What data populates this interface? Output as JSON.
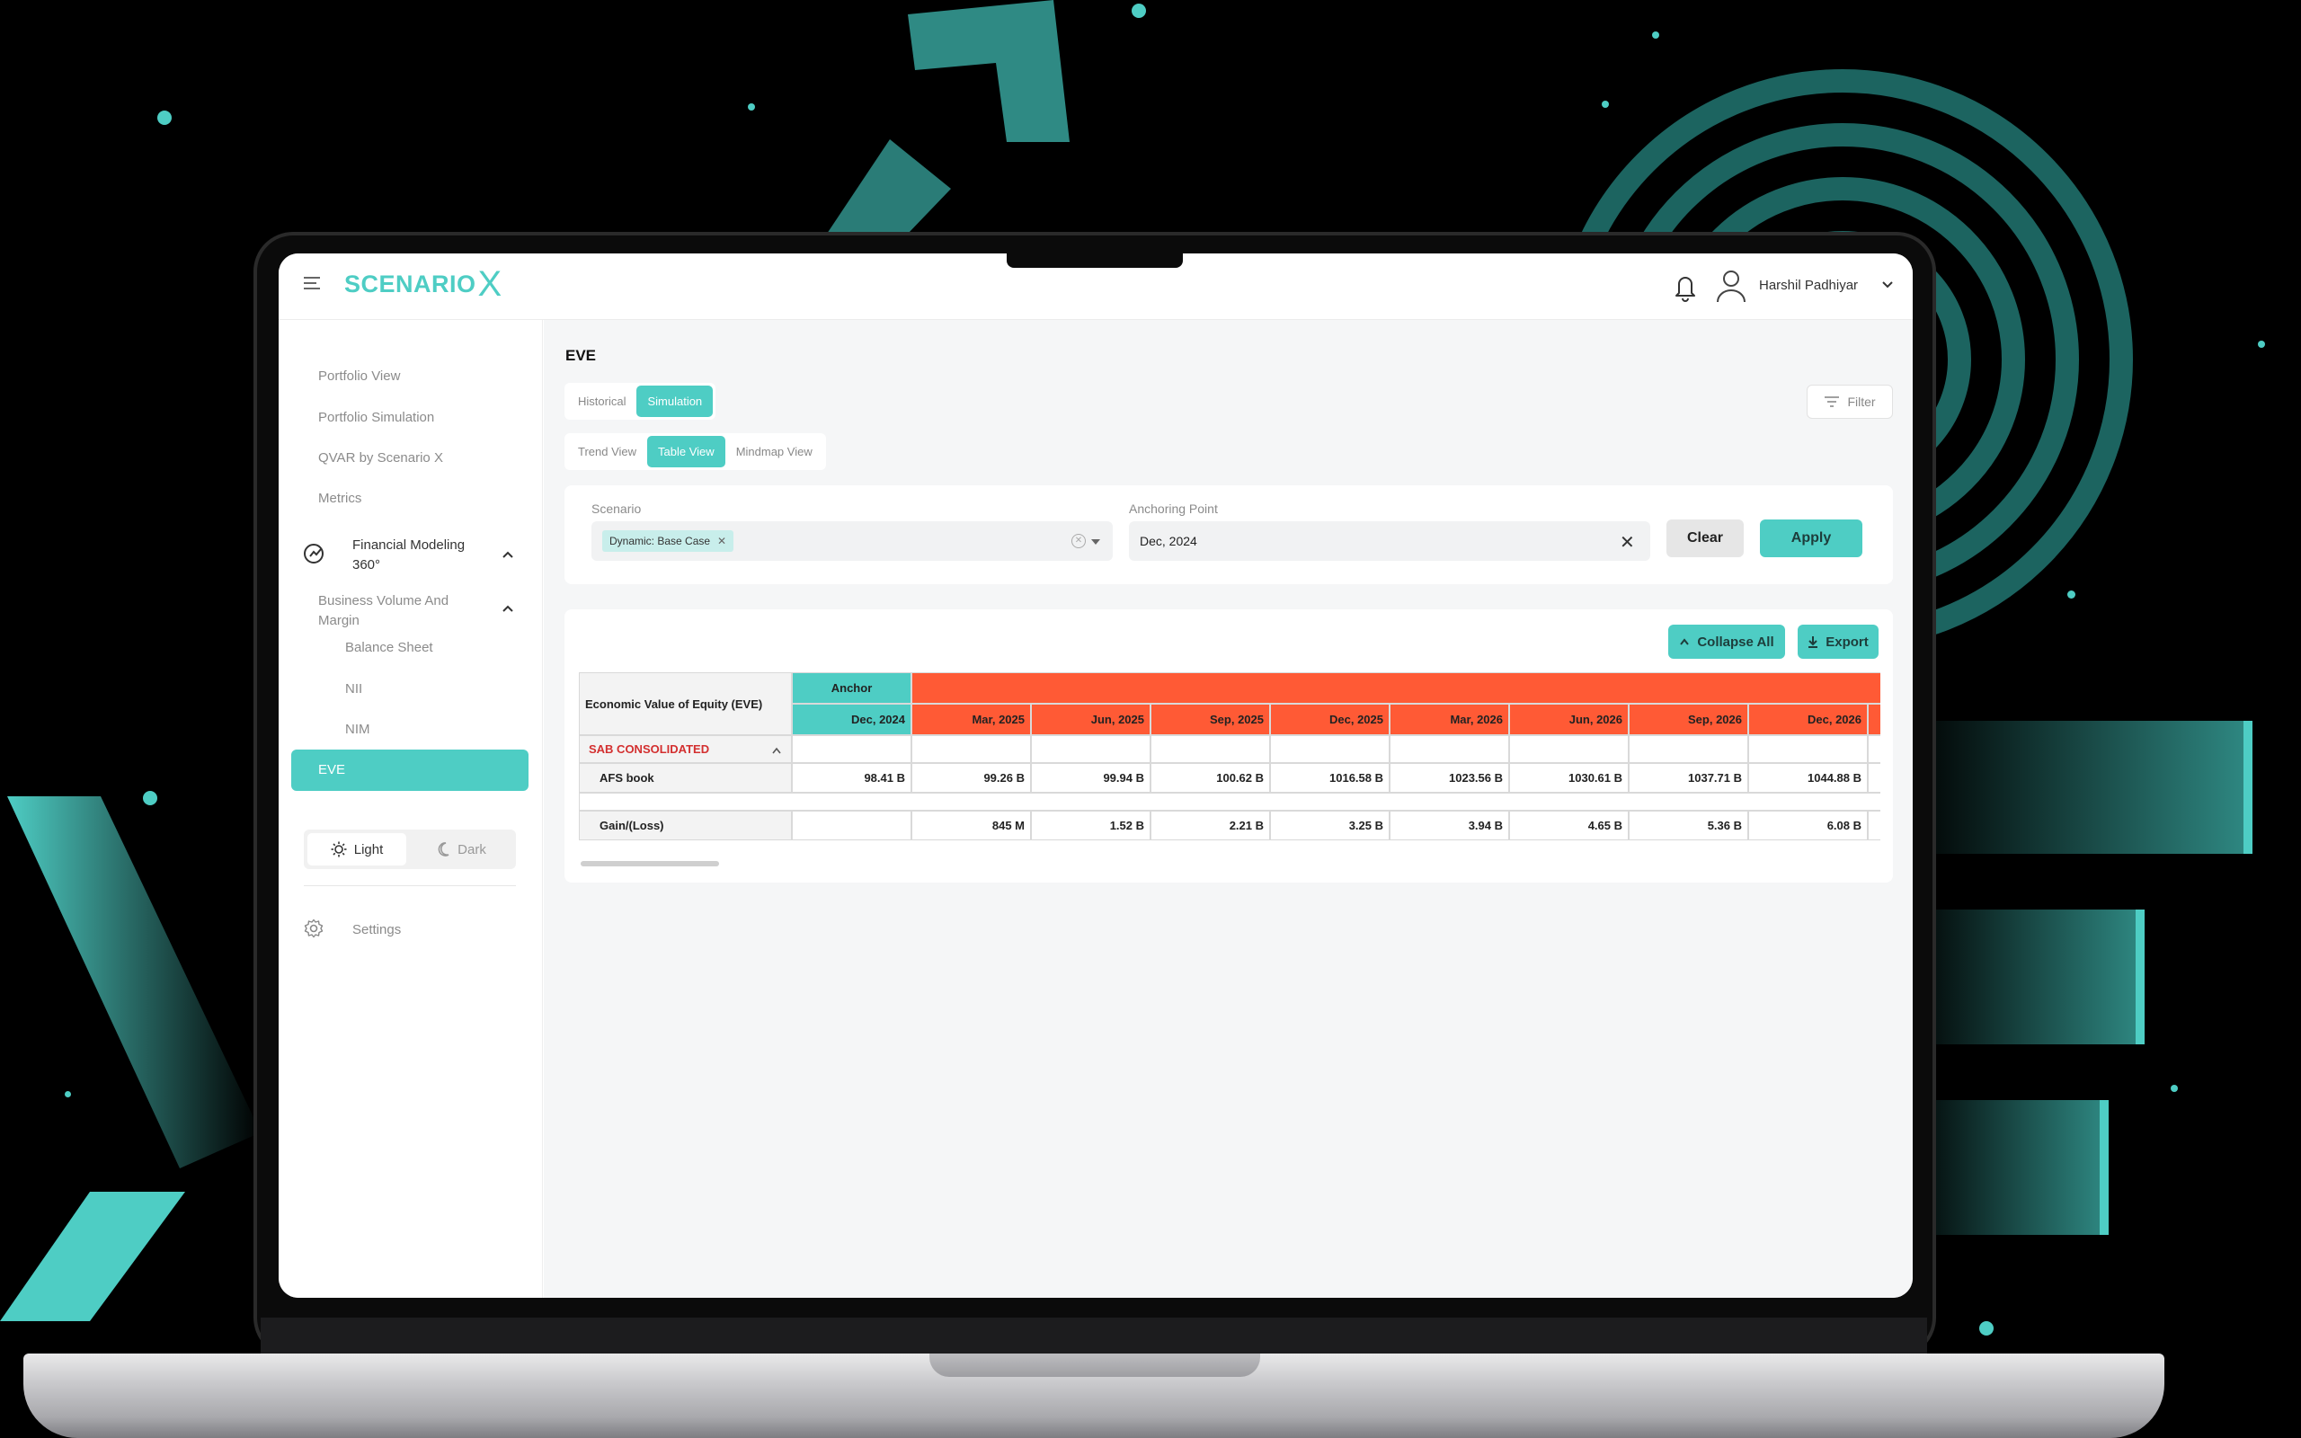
{
  "header": {
    "logo_text": "SCENARIO",
    "logo_mark": "X",
    "user_name": "Harshil Padhiyar"
  },
  "sidebar": {
    "items": [
      {
        "label": "Portfolio View"
      },
      {
        "label": "Portfolio Simulation"
      },
      {
        "label": "QVAR by Scenario X"
      },
      {
        "label": "Metrics"
      }
    ],
    "financial_modeling": "Financial Modeling 360°",
    "business_volume": "Business Volume And Margin",
    "sub_items": [
      {
        "label": "Balance Sheet"
      },
      {
        "label": "NII"
      },
      {
        "label": "NIM"
      }
    ],
    "active_item": "EVE",
    "theme": {
      "light": "Light",
      "dark": "Dark"
    },
    "settings": "Settings"
  },
  "main": {
    "title": "EVE",
    "mode_tabs": [
      {
        "label": "Historical",
        "active": false
      },
      {
        "label": "Simulation",
        "active": true
      }
    ],
    "view_tabs": [
      {
        "label": "Trend View",
        "active": false
      },
      {
        "label": "Table View",
        "active": true
      },
      {
        "label": "Mindmap View",
        "active": false
      }
    ],
    "filter_label": "Filter",
    "scenario": {
      "label": "Scenario",
      "chip": "Dynamic: Base Case"
    },
    "anchoring": {
      "label": "Anchoring Point",
      "value": "Dec, 2024"
    },
    "clear_label": "Clear",
    "apply_label": "Apply",
    "collapse_label": "Collapse All",
    "export_label": "Export"
  },
  "table": {
    "corner_label": "Economic Value of Equity (EVE)",
    "anchor_group": "Anchor",
    "columns": [
      "Dec, 2024",
      "Mar, 2025",
      "Jun, 2025",
      "Sep, 2025",
      "Dec, 2025",
      "Mar, 2026",
      "Jun, 2026",
      "Sep, 2026",
      "Dec, 2026"
    ],
    "group": "SAB CONSOLIDATED",
    "rows": [
      {
        "label": "AFS book",
        "values": [
          "98.41 B",
          "99.26 B",
          "99.94 B",
          "100.62 B",
          "1016.58 B",
          "1023.56 B",
          "1030.61 B",
          "1037.71 B",
          "1044.88 B"
        ]
      },
      {
        "label": "Gain/(Loss)",
        "values": [
          "",
          "845 M",
          "1.52 B",
          "2.21 B",
          "3.25 B",
          "3.94 B",
          "4.65 B",
          "5.36 B",
          "6.08 B"
        ]
      }
    ]
  },
  "colors": {
    "accent": "#4ecdc4",
    "header_orange": "#ff5a35",
    "group_red": "#d32f2f"
  }
}
